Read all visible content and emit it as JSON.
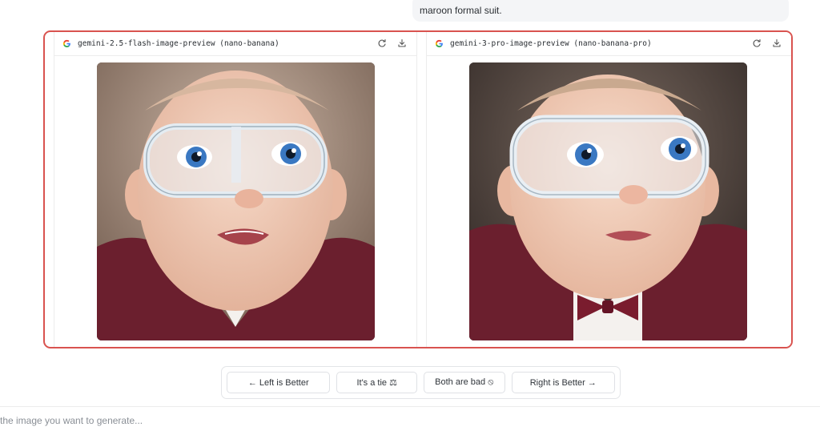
{
  "prompt": {
    "text": "maroon formal suit."
  },
  "left_panel": {
    "model": "gemini-2.5-flash-image-preview (nano-banana)",
    "regenerate_icon": "refresh-icon",
    "download_icon": "download-icon",
    "image_alt": "Baby wearing clear safety goggles and a maroon blazer"
  },
  "right_panel": {
    "model": "gemini-3-pro-image-preview (nano-banana-pro)",
    "regenerate_icon": "refresh-icon",
    "download_icon": "download-icon",
    "image_alt": "Baby wearing clear safety goggles, maroon blazer and bow tie"
  },
  "vote": {
    "left": "← Left is Better",
    "tie": "It's a tie ⚖",
    "bad": "Both are bad ⦸",
    "right": "Right is Better →"
  },
  "input": {
    "placeholder": "the image you want to generate..."
  },
  "colors": {
    "frame_border": "#d9534f",
    "suit": "#6b1f2e",
    "iris": "#3a78c2"
  }
}
